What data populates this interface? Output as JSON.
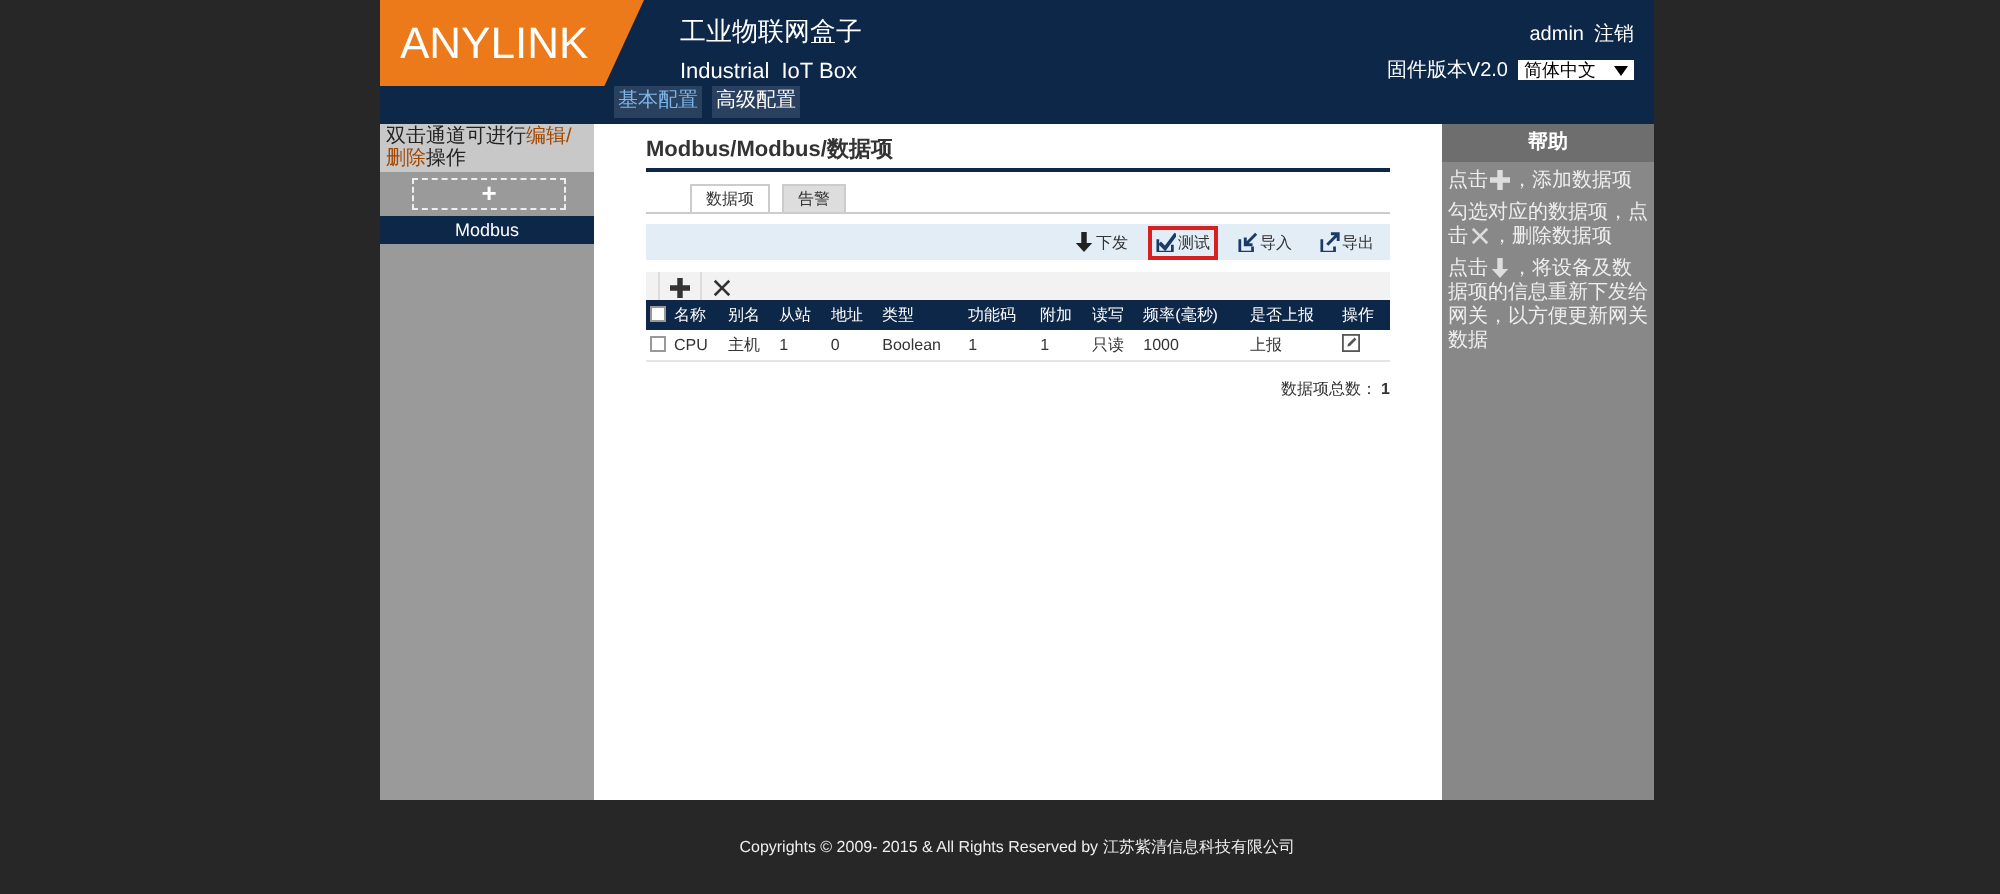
{
  "header": {
    "logo": "ANYLINK",
    "title_cn": "工业物联网盒子",
    "title_en": "Industrial  IoT Box",
    "user": "admin",
    "logout": "注销",
    "firmware": "固件版本V2.0",
    "language": "简体中文"
  },
  "nav_tabs": [
    {
      "label": "基本配置",
      "selected": true
    },
    {
      "label": "高级配置",
      "selected": false
    }
  ],
  "sidebar": {
    "notice": [
      "双击通道可进行",
      "编辑/删除",
      "操作"
    ],
    "add_button": "+",
    "channels": [
      {
        "label": "Modbus",
        "selected": true
      }
    ]
  },
  "main": {
    "breadcrumb": "Modbus/Modbus/数据项",
    "tabs": [
      {
        "label": "数据项",
        "selected": true
      },
      {
        "label": "告警",
        "selected": false
      }
    ],
    "actions": [
      {
        "kind": "download",
        "label": "下发",
        "highlighted": false
      },
      {
        "kind": "test",
        "label": "测试",
        "highlighted": true
      },
      {
        "kind": "import",
        "label": "导入",
        "highlighted": false
      },
      {
        "kind": "export",
        "label": "导出",
        "highlighted": false
      }
    ],
    "table_tools": [
      {
        "kind": "add"
      },
      {
        "kind": "delete"
      }
    ],
    "all_checked": false,
    "columns": [
      "名称",
      "别名",
      "从站",
      "地址",
      "类型",
      "功能码",
      "附加",
      "读写",
      "频率(毫秒)",
      "是否上报",
      "操作"
    ],
    "rows": [
      {
        "checked": false,
        "cells": [
          "CPU",
          "主机",
          "1",
          "0",
          "Boolean",
          "1",
          "1",
          "只读",
          "1000",
          "上报"
        ]
      }
    ],
    "total_label": "数据项总数：",
    "total": "1"
  },
  "help": {
    "title": "帮助",
    "items": [
      {
        "before": "点击",
        "kind": "add",
        "after": "，添加数据项"
      },
      {
        "before": "勾选对应的数据项，点击",
        "kind": "delete",
        "after": "，删除数据项"
      },
      {
        "before": "点击",
        "kind": "download",
        "after": "，将设备及数据项的信息重新下发给网关，以方便更新网关数据"
      }
    ]
  },
  "footer": "Copyrights © 2009- 2015 & All Rights Reserved by 江苏紫清信息科技有限公司"
}
